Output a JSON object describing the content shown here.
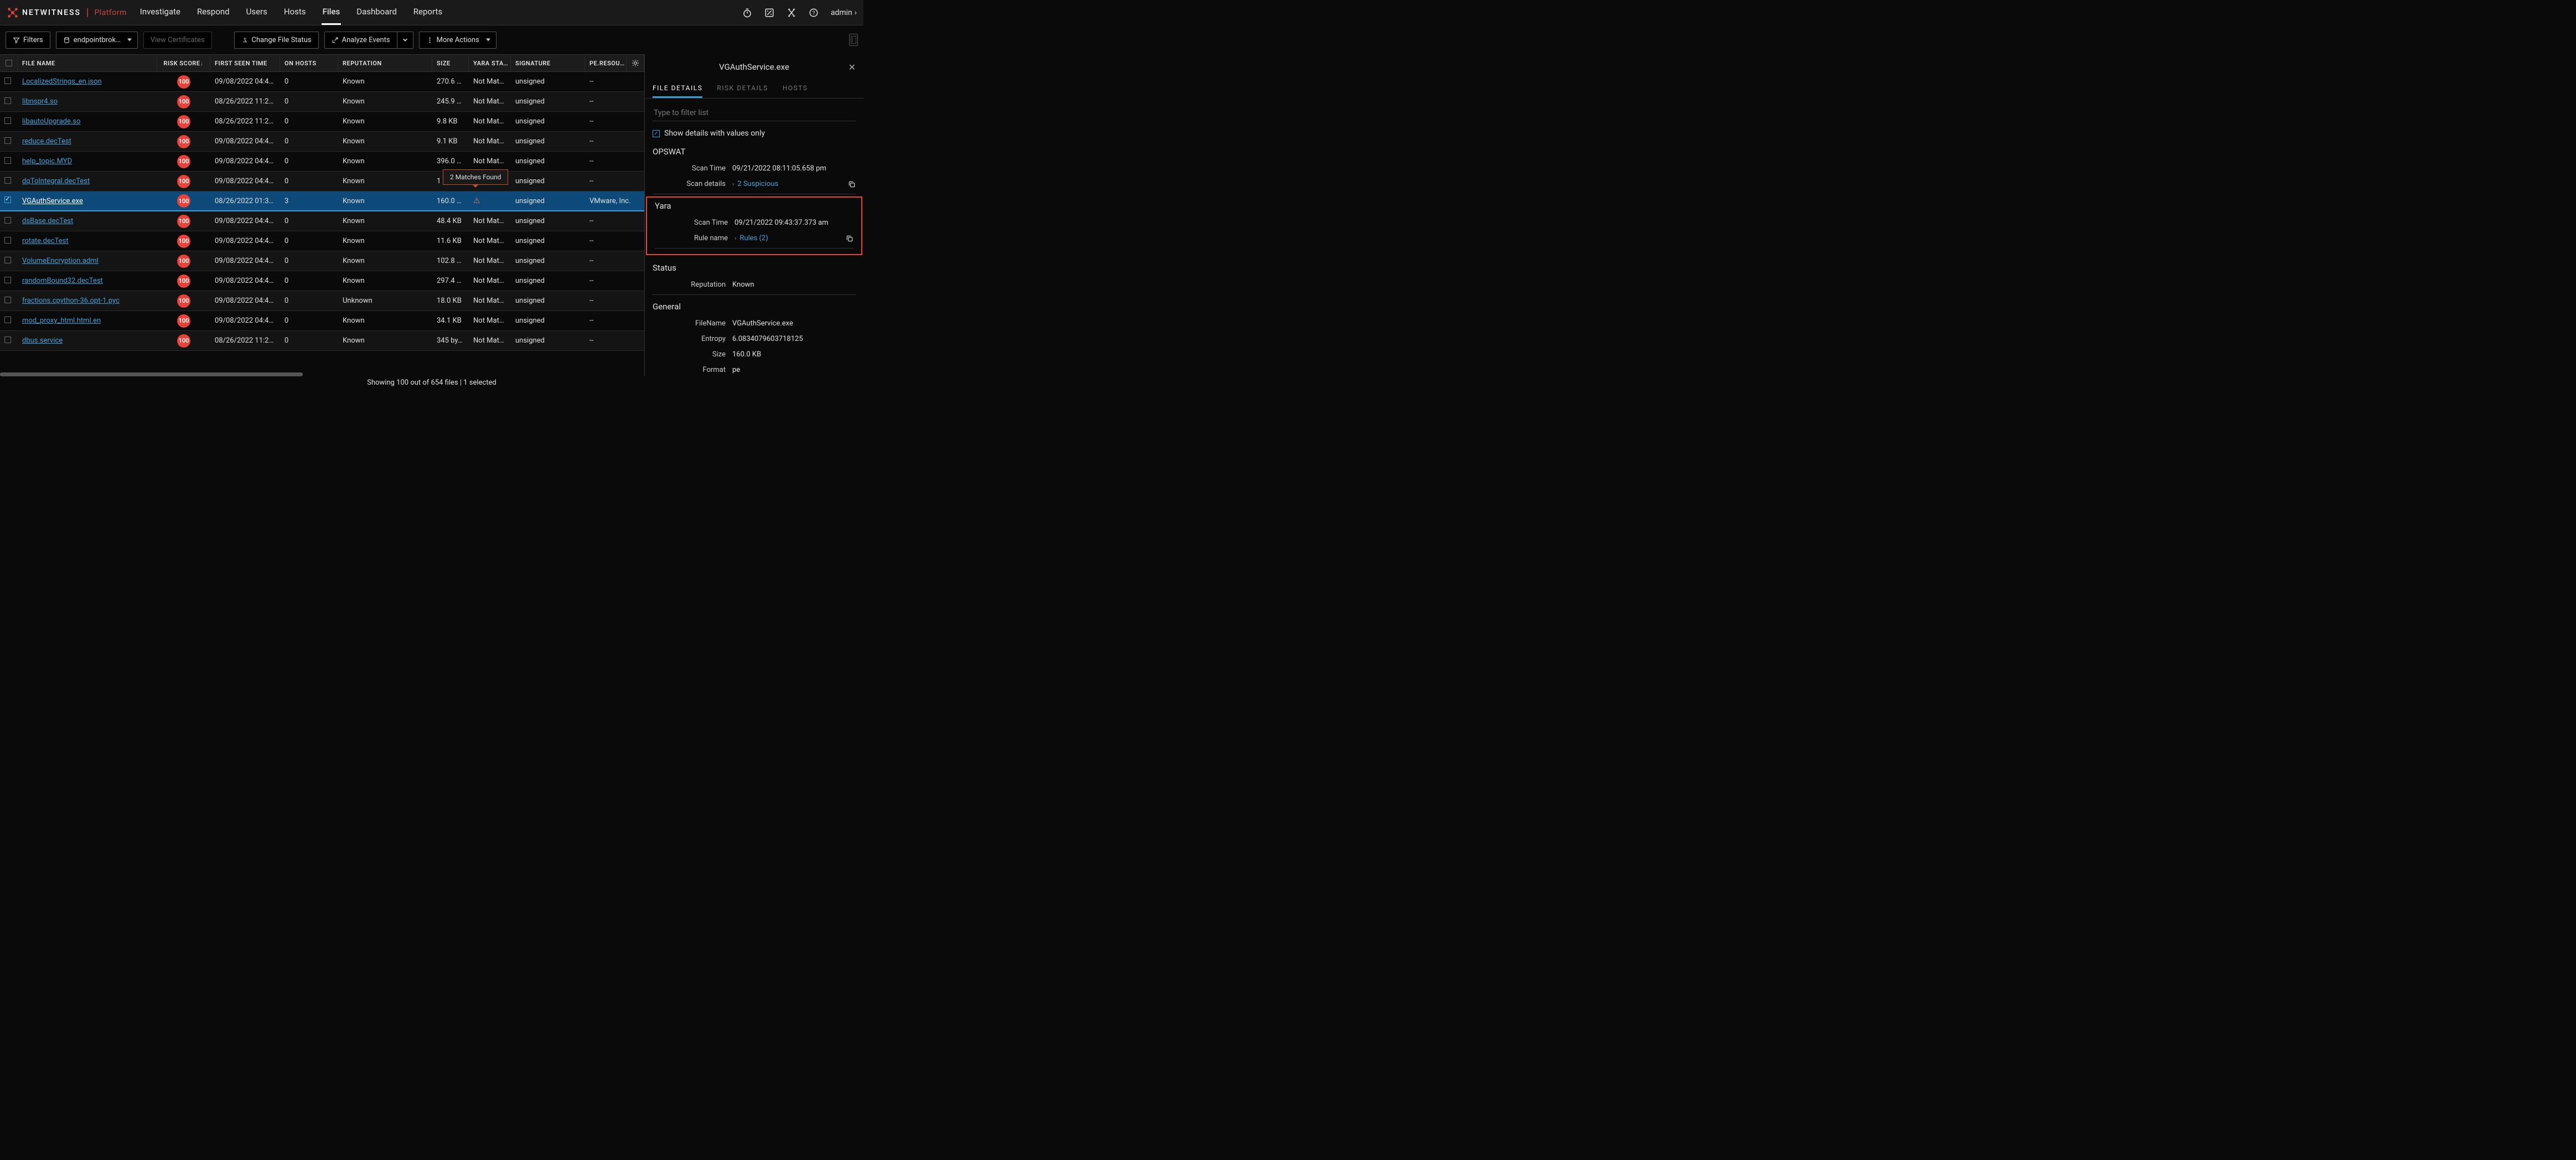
{
  "brand": {
    "name": "NETWITNESS",
    "suffix": "Platform"
  },
  "nav": [
    "Investigate",
    "Respond",
    "Users",
    "Hosts",
    "Files",
    "Dashboard",
    "Reports"
  ],
  "nav_active": 4,
  "user": "admin",
  "toolbar": {
    "filters": "Filters",
    "source": "endpointbrok…",
    "view_certs": "View Certificates",
    "change_status": "Change File Status",
    "analyze": "Analyze Events",
    "more": "More Actions"
  },
  "columns": {
    "cb": "",
    "name": "FILE NAME",
    "risk": "RISK SCORE",
    "first": "FIRST SEEN TIME",
    "onhosts": "ON HOSTS",
    "rep": "REPUTATION",
    "size": "SIZE",
    "yara": "YARA STA…",
    "sig": "SIGNATURE",
    "pe": "PE.RESOU…"
  },
  "rows": [
    {
      "name": "LocalizedStrings_en.json",
      "risk": "100",
      "first": "09/08/2022 04:47…",
      "hosts": "0",
      "rep": "Known",
      "size": "270.6 …",
      "yara": "Not Matc…",
      "sig": "unsigned",
      "pe": "--"
    },
    {
      "name": "libnspr4.so",
      "risk": "100",
      "first": "08/26/2022 11:22…",
      "hosts": "0",
      "rep": "Known",
      "size": "245.9 …",
      "yara": "Not Matc…",
      "sig": "unsigned",
      "pe": "--"
    },
    {
      "name": "libautoUpgrade.so",
      "risk": "100",
      "first": "08/26/2022 11:22…",
      "hosts": "0",
      "rep": "Known",
      "size": "9.8 KB",
      "yara": "Not Matc…",
      "sig": "unsigned",
      "pe": "--"
    },
    {
      "name": "reduce.decTest",
      "risk": "100",
      "first": "09/08/2022 04:47…",
      "hosts": "0",
      "rep": "Known",
      "size": "9.1 KB",
      "yara": "Not Matc…",
      "sig": "unsigned",
      "pe": "--"
    },
    {
      "name": "help_topic.MYD",
      "risk": "100",
      "first": "09/08/2022 04:47…",
      "hosts": "0",
      "rep": "Known",
      "size": "396.0 …",
      "yara": "Not Matc…",
      "sig": "unsigned",
      "pe": "--"
    },
    {
      "name": "dqToIntegral.decTest",
      "risk": "100",
      "first": "09/08/2022 04:47…",
      "hosts": "0",
      "rep": "Known",
      "size": "1",
      "yara": "",
      "sig": "unsigned",
      "pe": "--",
      "tooltip": "2 Matches Found"
    },
    {
      "name": "VGAuthService.exe",
      "risk": "100",
      "first": "08/26/2022 01:36…",
      "hosts": "3",
      "rep": "Known",
      "size": "160.0 …",
      "yara": "warn",
      "sig": "unsigned",
      "pe": "VMware, Inc.",
      "sel": true
    },
    {
      "name": "dsBase.decTest",
      "risk": "100",
      "first": "09/08/2022 04:47…",
      "hosts": "0",
      "rep": "Known",
      "size": "48.4 KB",
      "yara": "Not Matc…",
      "sig": "unsigned",
      "pe": "--"
    },
    {
      "name": "rotate.decTest",
      "risk": "100",
      "first": "09/08/2022 04:47…",
      "hosts": "0",
      "rep": "Known",
      "size": "11.6 KB",
      "yara": "Not Matc…",
      "sig": "unsigned",
      "pe": "--"
    },
    {
      "name": "VolumeEncryption.adml",
      "risk": "100",
      "first": "09/08/2022 04:47…",
      "hosts": "0",
      "rep": "Known",
      "size": "102.8 …",
      "yara": "Not Matc…",
      "sig": "unsigned",
      "pe": "--"
    },
    {
      "name": "randomBound32.decTest",
      "risk": "100",
      "first": "09/08/2022 04:47…",
      "hosts": "0",
      "rep": "Known",
      "size": "297.4 …",
      "yara": "Not Matc…",
      "sig": "unsigned",
      "pe": "--"
    },
    {
      "name": "fractions.cpython-36.opt-1.pyc",
      "risk": "100",
      "first": "09/08/2022 04:47…",
      "hosts": "0",
      "rep": "Unknown",
      "size": "18.0 KB",
      "yara": "Not Matc…",
      "sig": "unsigned",
      "pe": "--"
    },
    {
      "name": "mod_proxy_html.html.en",
      "risk": "100",
      "first": "09/08/2022 04:47…",
      "hosts": "0",
      "rep": "Known",
      "size": "34.1 KB",
      "yara": "Not Matc…",
      "sig": "unsigned",
      "pe": "--"
    },
    {
      "name": "dbus.service",
      "risk": "100",
      "first": "08/26/2022 11:22…",
      "hosts": "0",
      "rep": "Known",
      "size": "345 by…",
      "yara": "Not Matc…",
      "sig": "unsigned",
      "pe": "--"
    }
  ],
  "footer": "Showing 100 out of 654 files | 1 selected",
  "panel": {
    "title": "VGAuthService.exe",
    "tabs": [
      "FILE DETAILS",
      "RISK DETAILS",
      "HOSTS"
    ],
    "tab_active": 0,
    "filter_ph": "Type to filter list",
    "show_values": "Show details with values only",
    "opswat": {
      "title": "OPSWAT",
      "scan_time_k": "Scan Time",
      "scan_time_v": "09/21/2022 08:11:05.658 pm",
      "scan_det_k": "Scan details",
      "scan_det_v": "2 Suspicious"
    },
    "yara": {
      "title": "Yara",
      "scan_time_k": "Scan Time",
      "scan_time_v": "09/21/2022 09:43:37.373 am",
      "rule_k": "Rule name",
      "rule_v": "Rules (2)"
    },
    "status": {
      "title": "Status",
      "rep_k": "Reputation",
      "rep_v": "Known"
    },
    "general": {
      "title": "General",
      "fn_k": "FileName",
      "fn_v": "VGAuthService.exe",
      "en_k": "Entropy",
      "en_v": "6.0834079603718125",
      "sz_k": "Size",
      "sz_v": "160.0 KB",
      "fm_k": "Format",
      "fm_v": "pe"
    }
  }
}
